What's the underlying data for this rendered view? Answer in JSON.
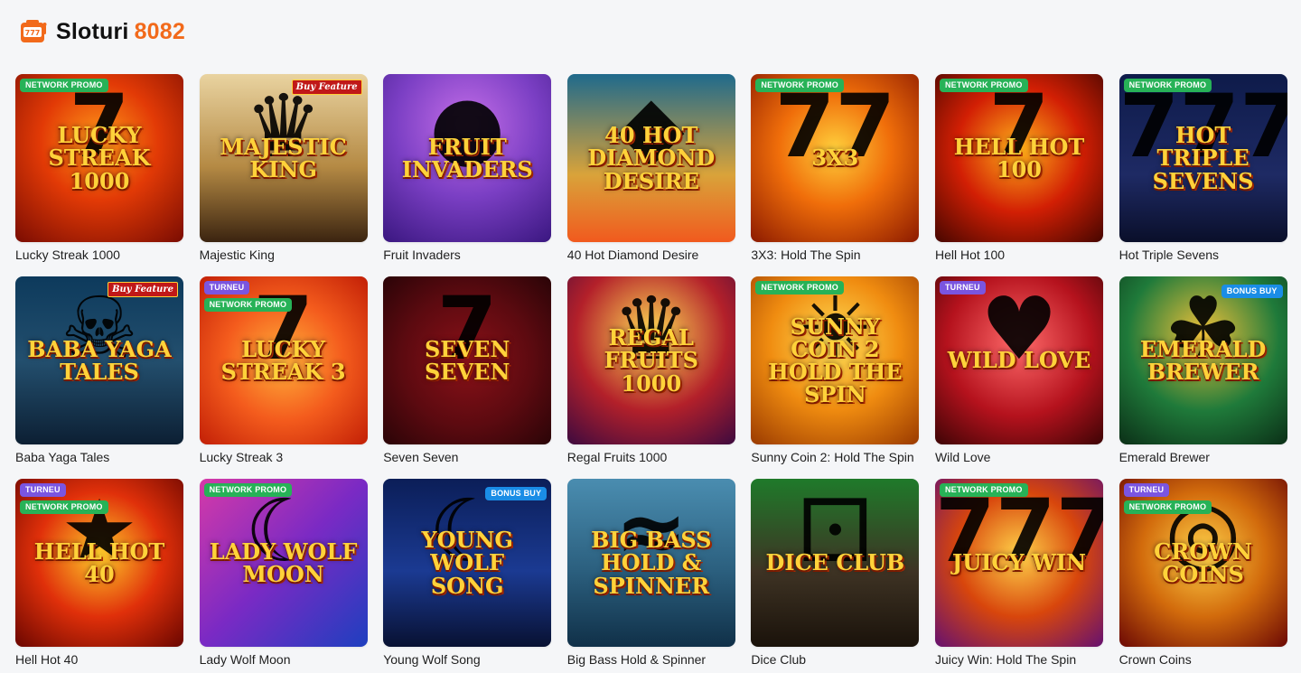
{
  "header": {
    "icon": "slot-machine-icon",
    "title": "Sloturi",
    "count": "8082",
    "accent_color": "#f26a1b"
  },
  "games": [
    {
      "name": "Lucky Streak 1000",
      "badges": [
        "NETWORK PROMO"
      ],
      "art": "Lucky Streak 1000",
      "glyph": "7"
    },
    {
      "name": "Majestic King",
      "badges": [],
      "buy_feature": "Buy Feature",
      "art": "Majestic King",
      "glyph": "♛"
    },
    {
      "name": "Fruit Invaders",
      "badges": [],
      "art": "Fruit Invaders",
      "glyph": "●"
    },
    {
      "name": "40 Hot Diamond Desire",
      "badges": [],
      "art": "40 Hot Diamond Desire",
      "glyph": "◆"
    },
    {
      "name": "3X3: Hold The Spin",
      "badges": [
        "NETWORK PROMO"
      ],
      "art": "3x3",
      "glyph": "77"
    },
    {
      "name": "Hell Hot 100",
      "badges": [
        "NETWORK PROMO"
      ],
      "art": "Hell Hot 100",
      "glyph": "7"
    },
    {
      "name": "Hot Triple Sevens",
      "badges": [
        "NETWORK PROMO"
      ],
      "art": "Hot Triple Sevens",
      "glyph": "777"
    },
    {
      "name": "Baba Yaga Tales",
      "badges": [],
      "buy_feature": "Buy Feature",
      "art": "Baba Yaga Tales",
      "glyph": "☠"
    },
    {
      "name": "Lucky Streak 3",
      "badges": [
        "TURNEU",
        "NETWORK PROMO"
      ],
      "art": "Lucky Streak 3",
      "glyph": "7"
    },
    {
      "name": "Seven Seven",
      "badges": [],
      "art": "Seven Seven",
      "glyph": "7"
    },
    {
      "name": "Regal Fruits 1000",
      "badges": [],
      "art": "Regal Fruits 1000",
      "glyph": "♛"
    },
    {
      "name": "Sunny Coin 2: Hold The Spin",
      "badges": [
        "NETWORK PROMO"
      ],
      "art": "Sunny Coin 2 Hold The Spin",
      "glyph": "☀"
    },
    {
      "name": "Wild Love",
      "badges": [
        "TURNEU"
      ],
      "art": "Wild Love",
      "glyph": "♥"
    },
    {
      "name": "Emerald Brewer",
      "badges": [],
      "bonus_buy": "BONUS BUY",
      "art": "Emerald Brewer",
      "glyph": "☘"
    },
    {
      "name": "Hell Hot 40",
      "badges": [
        "TURNEU",
        "NETWORK PROMO"
      ],
      "art": "Hell Hot 40",
      "glyph": "★"
    },
    {
      "name": "Lady Wolf Moon",
      "badges": [
        "NETWORK PROMO"
      ],
      "art": "Lady Wolf Moon",
      "glyph": "☾"
    },
    {
      "name": "Young Wolf Song",
      "badges": [],
      "bonus_buy": "BONUS BUY",
      "art": "Young Wolf Song",
      "glyph": "☾"
    },
    {
      "name": "Big Bass Hold & Spinner",
      "badges": [],
      "art": "Big Bass Hold & Spinner",
      "glyph": "≈"
    },
    {
      "name": "Dice Club",
      "badges": [],
      "art": "Dice Club",
      "glyph": "⚀"
    },
    {
      "name": "Juicy Win: Hold The Spin",
      "badges": [
        "NETWORK PROMO"
      ],
      "art": "Juicy Win",
      "glyph": "777"
    },
    {
      "name": "Crown Coins",
      "badges": [
        "TURNEU",
        "NETWORK PROMO"
      ],
      "art": "Crown Coins",
      "glyph": "◎"
    }
  ]
}
